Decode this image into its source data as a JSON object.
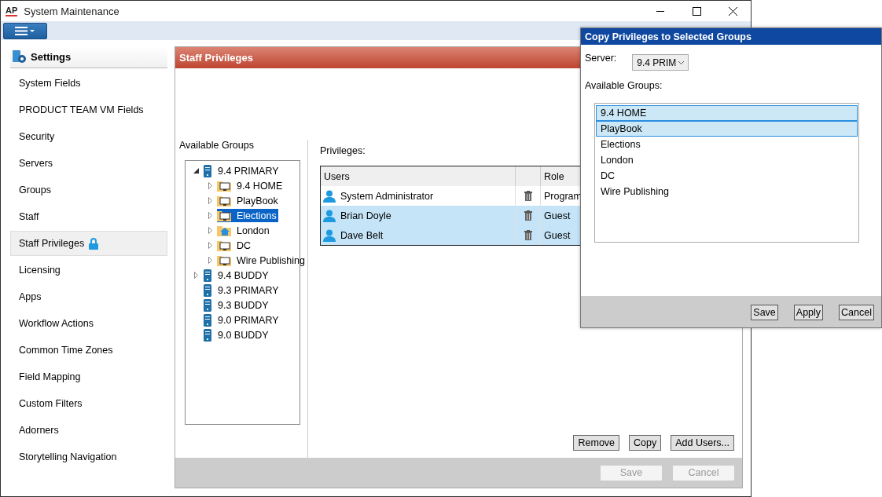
{
  "window": {
    "logo": "AP",
    "title": "System Maintenance"
  },
  "sidebar": {
    "title": "Settings",
    "items": [
      {
        "label": "System Fields",
        "selected": false,
        "locked": false
      },
      {
        "label": "PRODUCT TEAM VM Fields",
        "selected": false,
        "locked": false
      },
      {
        "label": "Security",
        "selected": false,
        "locked": false
      },
      {
        "label": "Servers",
        "selected": false,
        "locked": false
      },
      {
        "label": "Groups",
        "selected": false,
        "locked": false
      },
      {
        "label": "Staff",
        "selected": false,
        "locked": false
      },
      {
        "label": "Staff Privileges",
        "selected": true,
        "locked": true
      },
      {
        "label": "Licensing",
        "selected": false,
        "locked": false
      },
      {
        "label": "Apps",
        "selected": false,
        "locked": false
      },
      {
        "label": "Workflow Actions",
        "selected": false,
        "locked": false
      },
      {
        "label": "Common Time Zones",
        "selected": false,
        "locked": false
      },
      {
        "label": "Field Mapping",
        "selected": false,
        "locked": false
      },
      {
        "label": "Custom Filters",
        "selected": false,
        "locked": false
      },
      {
        "label": "Adorners",
        "selected": false,
        "locked": false
      },
      {
        "label": "Storytelling Navigation",
        "selected": false,
        "locked": false
      }
    ]
  },
  "panel": {
    "title": "Staff Privileges",
    "groups_label": "Available Groups",
    "tree": [
      {
        "label": "9.4 PRIMARY",
        "kind": "server",
        "expanded": true,
        "selected": false,
        "children": [
          {
            "label": "9.4 HOME",
            "kind": "folder",
            "expanded": false,
            "selected": false
          },
          {
            "label": "PlayBook",
            "kind": "folder",
            "expanded": false,
            "selected": false
          },
          {
            "label": "Elections",
            "kind": "folder",
            "expanded": false,
            "selected": true
          },
          {
            "label": "London",
            "kind": "home",
            "expanded": false,
            "selected": false
          },
          {
            "label": "DC",
            "kind": "folder",
            "expanded": false,
            "selected": false
          },
          {
            "label": "Wire Publishing",
            "kind": "folder",
            "expanded": false,
            "selected": false
          }
        ]
      },
      {
        "label": "9.4 BUDDY",
        "kind": "server",
        "expanded": false,
        "selected": false
      },
      {
        "label": "9.3 PRIMARY",
        "kind": "server",
        "selected": false
      },
      {
        "label": "9.3 BUDDY",
        "kind": "server",
        "selected": false
      },
      {
        "label": "9.0 PRIMARY",
        "kind": "server",
        "selected": false
      },
      {
        "label": "9.0 BUDDY",
        "kind": "server",
        "selected": false
      }
    ],
    "privileges_label": "Privileges:",
    "columns": [
      "Users",
      "Role"
    ],
    "rows": [
      {
        "user": "System Administrator",
        "role": "Program",
        "selected": false
      },
      {
        "user": "Brian Doyle",
        "role": "Guest",
        "selected": true
      },
      {
        "user": "Dave Belt",
        "role": "Guest",
        "selected": true
      }
    ],
    "actions": [
      {
        "label": "Remove",
        "disabled": false
      },
      {
        "label": "Copy",
        "disabled": false
      },
      {
        "label": "Add Users...",
        "disabled": false
      }
    ],
    "footer_buttons": [
      {
        "label": "Save",
        "disabled": true
      },
      {
        "label": "Cancel",
        "disabled": true
      }
    ]
  },
  "dialog": {
    "title": "Copy Privileges to Selected Groups",
    "server_label": "Server:",
    "server_value": "9.4 PRIM",
    "groups_label": "Available Groups:",
    "groups": [
      {
        "label": "9.4 HOME",
        "selected": true
      },
      {
        "label": "PlayBook",
        "selected": true
      },
      {
        "label": "Elections",
        "selected": false
      },
      {
        "label": "London",
        "selected": false
      },
      {
        "label": "DC",
        "selected": false
      },
      {
        "label": "Wire Publishing",
        "selected": false
      }
    ],
    "buttons": [
      "Save",
      "Apply",
      "Cancel"
    ]
  }
}
